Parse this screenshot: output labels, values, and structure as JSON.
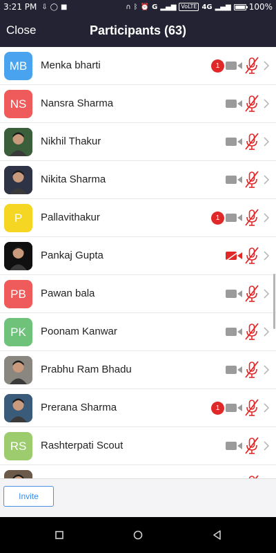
{
  "status_bar": {
    "time": "3:21 PM",
    "volte": "VoLTE",
    "network": "4G",
    "battery_percent": "100%",
    "battery_level": 1.0
  },
  "header": {
    "close_label": "Close",
    "title": "Participants (63)"
  },
  "participants": [
    {
      "name": "Menka bharti",
      "initials": "MB",
      "avatar_color": "#4aa3ef",
      "avatar_type": "initials",
      "unread": "1",
      "video_off_red": false,
      "muted": true
    },
    {
      "name": "Nansra Sharma",
      "initials": "NS",
      "avatar_color": "#ef5a5a",
      "avatar_type": "initials",
      "unread": "",
      "video_off_red": false,
      "muted": true
    },
    {
      "name": "Nikhil Thakur",
      "initials": "",
      "avatar_color": "#3b5f3a",
      "avatar_type": "photo",
      "unread": "",
      "video_off_red": false,
      "muted": true
    },
    {
      "name": "Nikita Sharma",
      "initials": "",
      "avatar_color": "#2f3346",
      "avatar_type": "photo",
      "unread": "",
      "video_off_red": false,
      "muted": true
    },
    {
      "name": "Pallavithakur",
      "initials": "P",
      "avatar_color": "#f5d623",
      "avatar_type": "initials",
      "unread": "1",
      "video_off_red": false,
      "muted": true
    },
    {
      "name": "Pankaj Gupta",
      "initials": "",
      "avatar_color": "#101010",
      "avatar_type": "photo",
      "unread": "",
      "video_off_red": true,
      "muted": true
    },
    {
      "name": "Pawan bala",
      "initials": "PB",
      "avatar_color": "#ef5a5a",
      "avatar_type": "initials",
      "unread": "",
      "video_off_red": false,
      "muted": true
    },
    {
      "name": "Poonam Kanwar",
      "initials": "PK",
      "avatar_color": "#6ec27a",
      "avatar_type": "initials",
      "unread": "",
      "video_off_red": false,
      "muted": true
    },
    {
      "name": "Prabhu Ram Bhadu",
      "initials": "",
      "avatar_color": "#8a8680",
      "avatar_type": "photo",
      "unread": "",
      "video_off_red": false,
      "muted": true
    },
    {
      "name": "Prerana Sharma",
      "initials": "",
      "avatar_color": "#3a5b7a",
      "avatar_type": "photo",
      "unread": "1",
      "video_off_red": false,
      "muted": true
    },
    {
      "name": "Rashterpati Scout",
      "initials": "RS",
      "avatar_color": "#9ccc6e",
      "avatar_type": "initials",
      "unread": "",
      "video_off_red": false,
      "muted": true
    },
    {
      "name": "",
      "initials": "",
      "avatar_color": "#6b5a4a",
      "avatar_type": "photo",
      "unread": "",
      "video_off_red": false,
      "muted": true
    }
  ],
  "footer": {
    "invite_label": "Invite"
  },
  "colors": {
    "header_bg": "#232333",
    "icon_grey": "#9b9b9b",
    "muted_red": "#e02828",
    "accent_blue": "#2d8cff"
  },
  "icons": [
    "camera-icon",
    "mic-off-icon",
    "chevron-right-icon",
    "recent-apps-icon",
    "home-icon",
    "back-icon"
  ]
}
